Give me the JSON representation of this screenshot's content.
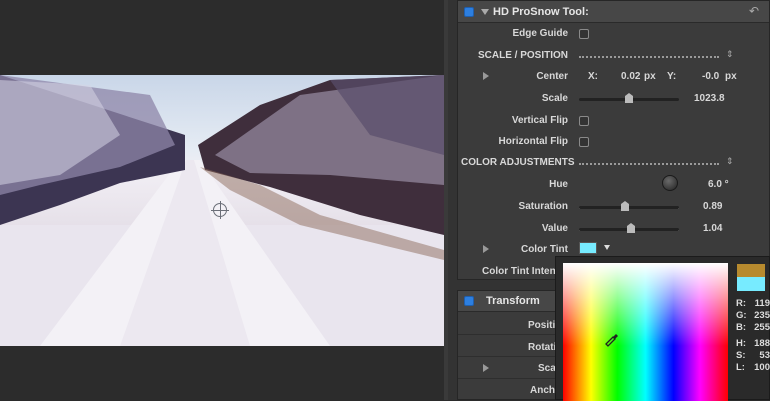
{
  "effect": {
    "title": "HD ProSnow Tool:",
    "edge_guide": "Edge Guide",
    "scale_position": "SCALE / POSITION",
    "center": {
      "label": "Center",
      "x_label": "X:",
      "x_value": "0.02",
      "x_unit": "px",
      "y_label": "Y:",
      "y_value": "-0.0",
      "y_unit": "px"
    },
    "scale": {
      "label": "Scale",
      "value": "1023.8"
    },
    "vertical_flip": "Vertical Flip",
    "horizontal_flip": "Horizontal Flip",
    "color_adjustments": "COLOR ADJUSTMENTS",
    "hue": {
      "label": "Hue",
      "value": "6.0 °"
    },
    "saturation": {
      "label": "Saturation",
      "value": "0.89"
    },
    "value": {
      "label": "Value",
      "value": "1.04"
    },
    "color_tint": {
      "label": "Color Tint",
      "color": "#77ebff"
    },
    "color_tint_intensity": "Color Tint Intens"
  },
  "transform": {
    "title": "Transform",
    "position": "Positi",
    "rotation": "Rotati",
    "scale": "Sca",
    "anchor": "Anch"
  },
  "picker": {
    "old_color": "#b78a2e",
    "new_color": "#77ebff",
    "r_label": "R:",
    "r": "119",
    "g_label": "G:",
    "g": "235",
    "b_label": "B:",
    "b": "255",
    "h_label": "H:",
    "h": "188",
    "s_label": "S:",
    "s": "53",
    "l_label": "L:",
    "l": "100"
  },
  "colors": {
    "accent": "#2d7fe0"
  }
}
